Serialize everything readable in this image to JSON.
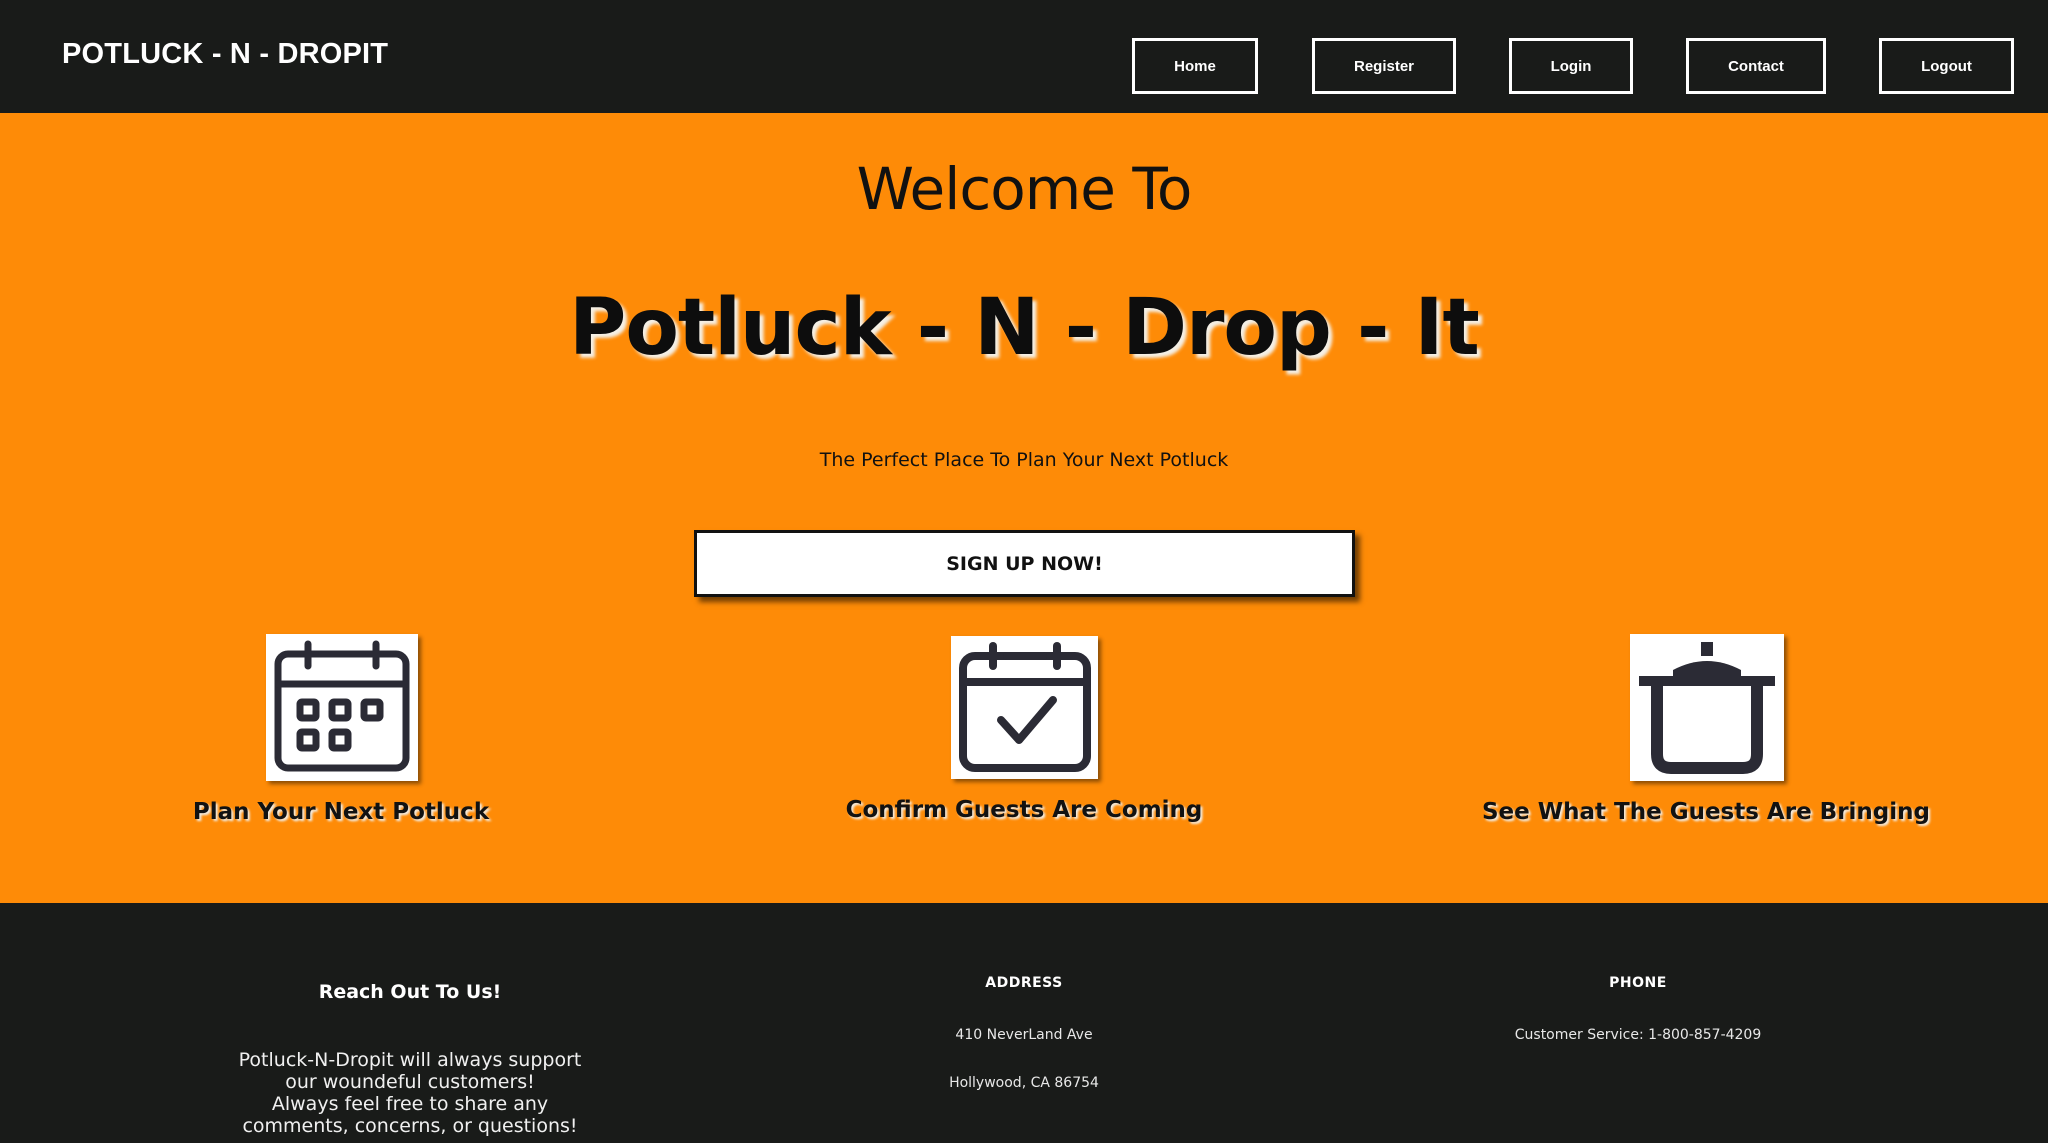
{
  "nav": {
    "brand": "POTLUCK - N - DROPIT",
    "links": [
      {
        "label": "Home"
      },
      {
        "label": "Register"
      },
      {
        "label": "Login"
      },
      {
        "label": "Contact"
      },
      {
        "label": "Logout"
      }
    ]
  },
  "hero": {
    "welcome": "Welcome To",
    "title": "Potluck - N - Drop - It",
    "tagline": "The Perfect Place To Plan Your Next Potluck",
    "cta_label": "SIGN UP NOW!"
  },
  "features": [
    {
      "icon": "calendar-icon",
      "label": "Plan Your Next Potluck"
    },
    {
      "icon": "calendar-check-icon",
      "label": "Confirm Guests Are Coming"
    },
    {
      "icon": "cooking-pot-icon",
      "label": "See What The Guests Are Bringing"
    }
  ],
  "footer": {
    "reach": {
      "heading": "Reach Out To Us!",
      "lines": [
        "Potluck-N-Dropit will always support",
        "our woundeful customers!",
        "Always feel free to share any",
        "comments, concerns, or questions!"
      ]
    },
    "address": {
      "heading": "ADDRESS",
      "line1": "410 NeverLand Ave",
      "line2": "Hollywood, CA 86754"
    },
    "phone": {
      "heading": "PHONE",
      "line": "Customer Service: 1-800-857-4209"
    }
  },
  "colors": {
    "hero_bg": "#fe8b07",
    "dark_bg": "#191b19",
    "icon_stroke": "#2b2b35"
  }
}
